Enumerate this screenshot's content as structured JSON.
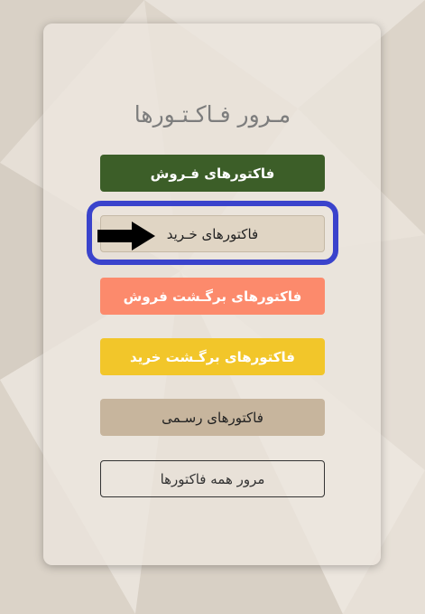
{
  "page": {
    "title": "مـرور فـاکـتـورها"
  },
  "buttons": {
    "sales": "فاکتورهای فـروش",
    "purchase": "فاکتورهای خـرید",
    "sales_return": "فاکتورهای برگـشت فروش",
    "purchase_return": "فاکتورهای برگـشت خرید",
    "official": "فاکتورهای رسـمی",
    "all": "مرور همه فاکتورها"
  },
  "annotation": {
    "highlight_color": "#3a43cc",
    "arrow_icon": "right-arrow-icon",
    "highlight_target": "purchase"
  },
  "colors": {
    "sales": "#3c5e28",
    "purchase": "#e0d5c4",
    "sales_return": "#fc8a6c",
    "purchase_return": "#f2c62a",
    "official": "#c7b59d"
  }
}
